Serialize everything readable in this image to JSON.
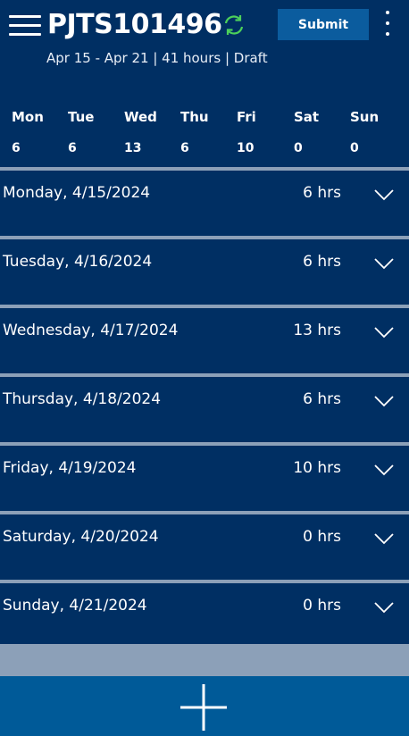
{
  "header": {
    "title": "PJTS101496",
    "subtitle": "Apr 15 - Apr 21 | 41 hours | Draft",
    "submit_label": "Submit",
    "icons": {
      "menu": "menu-icon",
      "refresh": "refresh-icon",
      "more": "more-vertical-icon"
    },
    "refresh_color": "#4cd05a"
  },
  "week_summary": [
    {
      "day": "Mon",
      "hours": "6"
    },
    {
      "day": "Tue",
      "hours": "6"
    },
    {
      "day": "Wed",
      "hours": "13"
    },
    {
      "day": "Thu",
      "hours": "6"
    },
    {
      "day": "Fri",
      "hours": "10"
    },
    {
      "day": "Sat",
      "hours": "0"
    },
    {
      "day": "Sun",
      "hours": "0"
    }
  ],
  "days": [
    {
      "label": "Monday, 4/15/2024",
      "hours": "6 hrs"
    },
    {
      "label": "Tuesday, 4/16/2024",
      "hours": "6 hrs"
    },
    {
      "label": "Wednesday, 4/17/2024",
      "hours": "13 hrs"
    },
    {
      "label": "Thursday, 4/18/2024",
      "hours": "6 hrs"
    },
    {
      "label": "Friday, 4/19/2024",
      "hours": "10 hrs"
    },
    {
      "label": "Saturday, 4/20/2024",
      "hours": "0 hrs"
    },
    {
      "label": "Sunday, 4/21/2024",
      "hours": "0 hrs"
    }
  ],
  "footer": {
    "add_icon": "plus-icon"
  },
  "colors": {
    "background": "#002f63",
    "separator": "#8ca0b8",
    "submit_button": "#0b5c9e",
    "add_bar": "#005a98"
  }
}
